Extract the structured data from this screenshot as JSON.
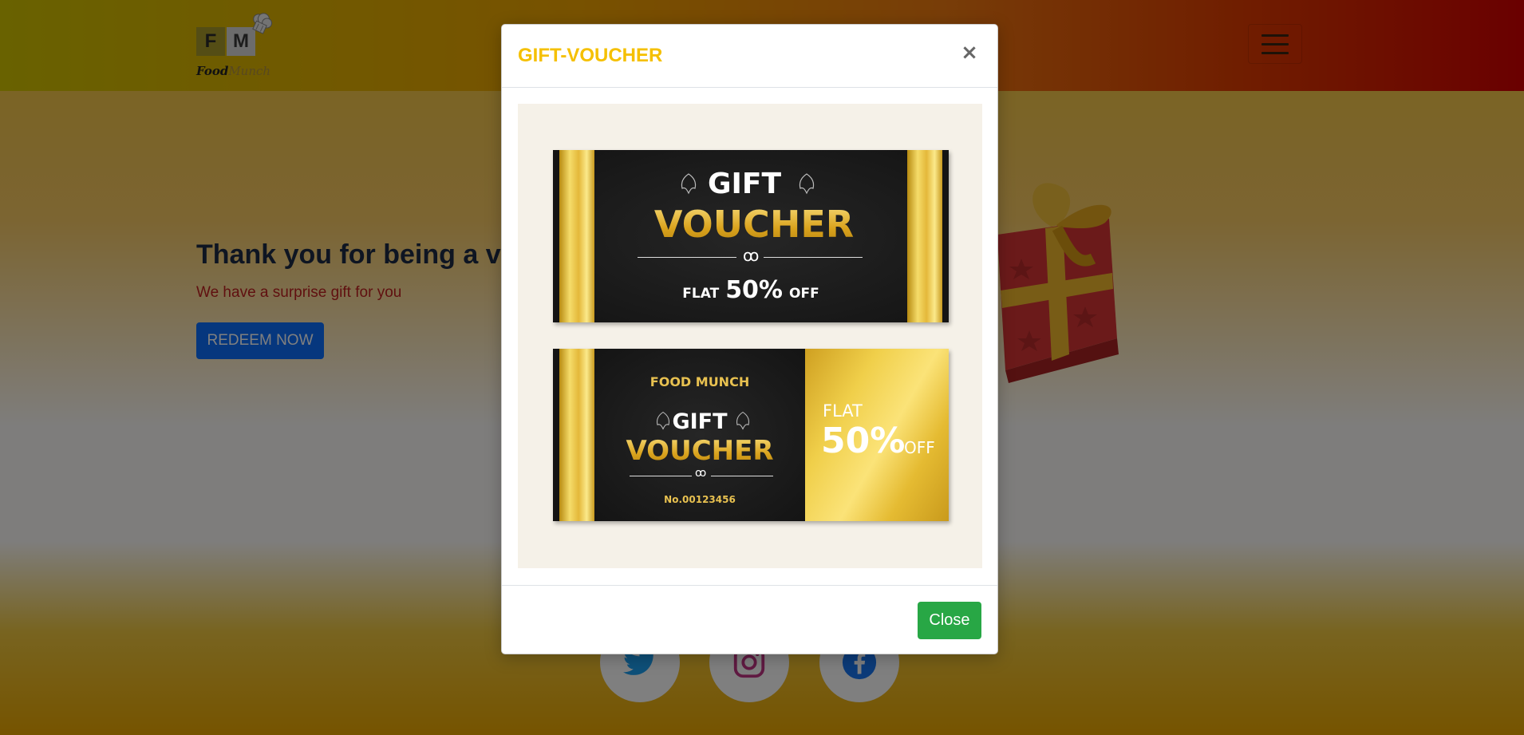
{
  "brand": {
    "logo_f": "F",
    "logo_m": "M",
    "logo_food": "Food",
    "logo_munch": "Munch"
  },
  "hero": {
    "title": "Thank you for being a valued customer",
    "subtitle": "We have a surprise gift for you",
    "redeem_label": "REDEEM NOW"
  },
  "modal": {
    "title": "GIFT-VOUCHER",
    "close_x": "×",
    "close_label": "Close"
  },
  "voucher_1": {
    "gift": "GIFT",
    "voucher": "VOUCHER",
    "flat": "FLAT",
    "percent": "50%",
    "off": "OFF"
  },
  "voucher_2": {
    "brand": "FOOD MUNCH",
    "gift": "GIFT",
    "voucher": "VOUCHER",
    "number": "No.00123456",
    "flat": "FLAT",
    "percent": "50%",
    "off": "OFF"
  },
  "icons": {
    "menu": "hamburger-icon",
    "chef_hat": "chef-hat-icon",
    "gift_box": "gift-box-icon",
    "twitter": "twitter-icon",
    "instagram": "instagram-icon",
    "facebook": "facebook-icon"
  },
  "colors": {
    "modal_title": "#f5c000",
    "close_button": "#28a745",
    "redeem_button": "#0d6efd",
    "subtitle": "#c02020"
  }
}
